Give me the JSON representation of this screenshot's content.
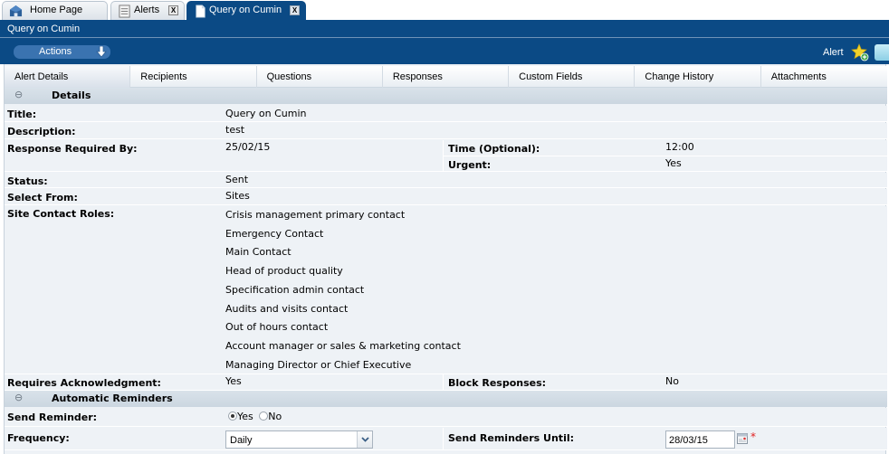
{
  "tabs": [
    {
      "label": "Home Page",
      "icon": "home-icon",
      "closable": false,
      "active": false
    },
    {
      "label": "Alerts",
      "icon": "list-icon",
      "closable": true,
      "active": false
    },
    {
      "label": "Query on Cumin",
      "icon": "document-icon",
      "closable": true,
      "active": true
    }
  ],
  "close_glyph": "X",
  "title_bar": "Query on Cumin",
  "actions": {
    "label": "Actions",
    "alert_label": "Alert"
  },
  "subtabs": [
    {
      "label": "Alert Details",
      "active": true
    },
    {
      "label": "Recipients"
    },
    {
      "label": "Questions"
    },
    {
      "label": "Responses"
    },
    {
      "label": "Custom Fields"
    },
    {
      "label": "Change History"
    },
    {
      "label": "Attachments"
    }
  ],
  "details": {
    "header": "Details",
    "toggle": "⊖",
    "title_label": "Title:",
    "title_value": "Query on Cumin",
    "description_label": "Description:",
    "description_value": "test",
    "response_required_label": "Response Required By:",
    "response_required_value": "25/02/15",
    "time_label": "Time (Optional):",
    "time_value": "12:00",
    "urgent_label": "Urgent:",
    "urgent_value": "Yes",
    "status_label": "Status:",
    "status_value": "Sent",
    "select_from_label": "Select From:",
    "select_from_value": "Sites",
    "site_contact_roles_label": "Site Contact Roles:",
    "site_contact_roles": [
      "Crisis management primary contact",
      "Emergency Contact",
      "Main Contact",
      "Head of product quality",
      "Specification admin contact",
      "Audits and visits contact",
      "Out of hours contact",
      "Account manager or sales & marketing contact",
      "Managing Director or Chief Executive"
    ],
    "requires_ack_label": "Requires Acknowledgment:",
    "requires_ack_value": "Yes",
    "block_responses_label": "Block Responses:",
    "block_responses_value": "No"
  },
  "reminders": {
    "header": "Automatic Reminders",
    "toggle": "⊖",
    "send_reminder_label": "Send Reminder:",
    "send_reminder_options": [
      "Yes",
      "No"
    ],
    "send_reminder_selected": "Yes",
    "frequency_label": "Frequency:",
    "frequency_value": "Daily",
    "send_until_label": "Send Reminders Until:",
    "send_until_value": "28/03/15",
    "required_marker": "*"
  }
}
